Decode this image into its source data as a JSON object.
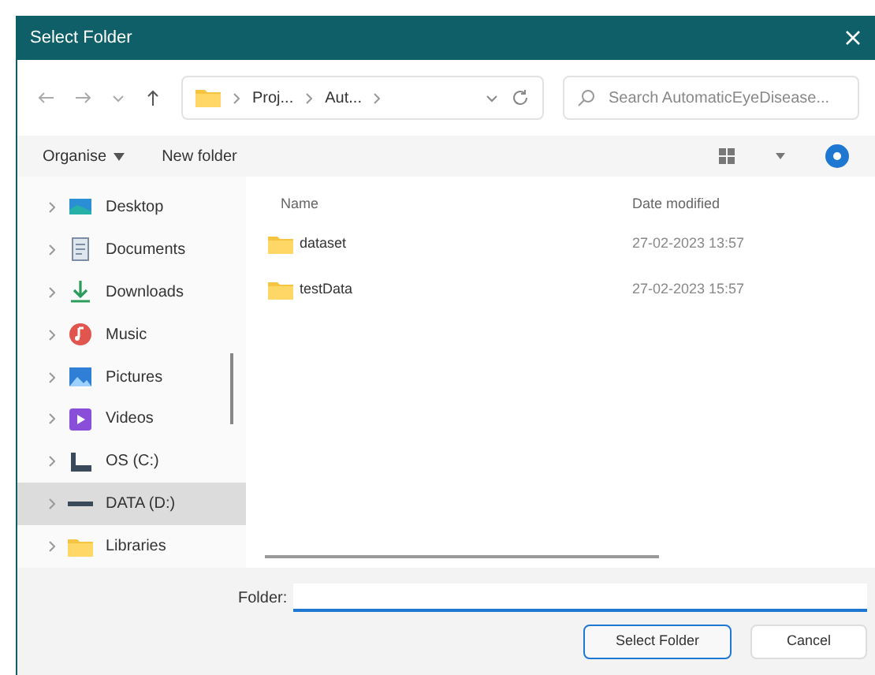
{
  "window": {
    "title": "Select Folder"
  },
  "address": {
    "segments": [
      "Proj...",
      "Aut..."
    ]
  },
  "search": {
    "placeholder": "Search AutomaticEyeDisease..."
  },
  "commands": {
    "organise": "Organise",
    "new_folder": "New folder"
  },
  "sidebar": {
    "items": [
      {
        "label": "Desktop",
        "kind": "desktop",
        "selected": false
      },
      {
        "label": "Documents",
        "kind": "documents",
        "selected": false
      },
      {
        "label": "Downloads",
        "kind": "downloads",
        "selected": false
      },
      {
        "label": "Music",
        "kind": "music",
        "selected": false
      },
      {
        "label": "Pictures",
        "kind": "pictures",
        "selected": false
      },
      {
        "label": "Videos",
        "kind": "videos",
        "selected": false
      },
      {
        "label": "OS (C:)",
        "kind": "drive",
        "selected": false
      },
      {
        "label": "DATA (D:)",
        "kind": "disk",
        "selected": true
      },
      {
        "label": "Libraries",
        "kind": "folder",
        "selected": false
      }
    ]
  },
  "table": {
    "columns": [
      "Name",
      "Date modified"
    ],
    "rows": [
      {
        "name": "dataset",
        "date": "27-02-2023 13:57"
      },
      {
        "name": "testData",
        "date": "27-02-2023 15:57"
      }
    ]
  },
  "folder_field": {
    "label": "Folder:"
  },
  "buttons": [
    "Select Folder",
    "Cancel"
  ]
}
